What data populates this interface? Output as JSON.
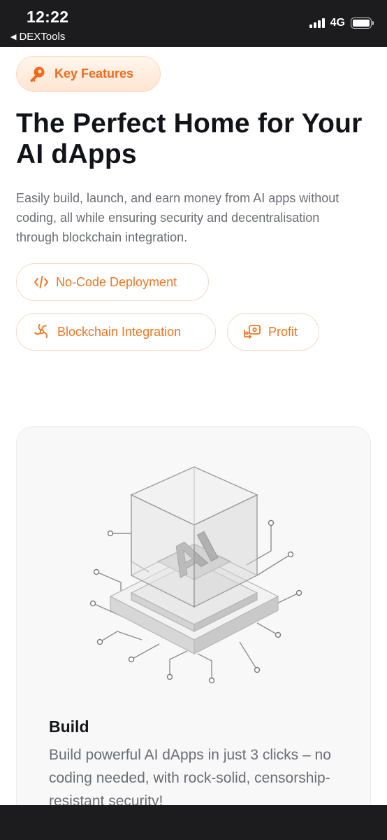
{
  "status_bar": {
    "time": "12:22",
    "back_label": "DEXTools",
    "network": "4G",
    "signal_icon": "signal-bars-icon",
    "battery_icon": "battery-icon"
  },
  "badge": {
    "label": "Key Features",
    "icon": "key-icon",
    "accent_color": "#f26a1b"
  },
  "hero": {
    "title": "The Perfect Home for Your AI dApps",
    "description": "Easily build, launch, and earn money from AI apps without coding, all while ensuring security and decentralisation through blockchain integration."
  },
  "features": [
    {
      "label": "No-Code Deployment",
      "icon": "code-icon"
    },
    {
      "label": "Blockchain Integration",
      "icon": "blockchain-swirl-icon"
    },
    {
      "label": "Profit",
      "icon": "profit-exchange-icon"
    }
  ],
  "card": {
    "illustration_text": "AI",
    "title": "Build",
    "description": "Build powerful AI dApps in just 3 clicks – no coding needed, with rock-solid, censorship-resistant security!"
  },
  "colors": {
    "accent": "#f07522",
    "status_bar_bg": "#1c1c1e",
    "heading": "#111318",
    "body_text": "#6a6d75"
  }
}
